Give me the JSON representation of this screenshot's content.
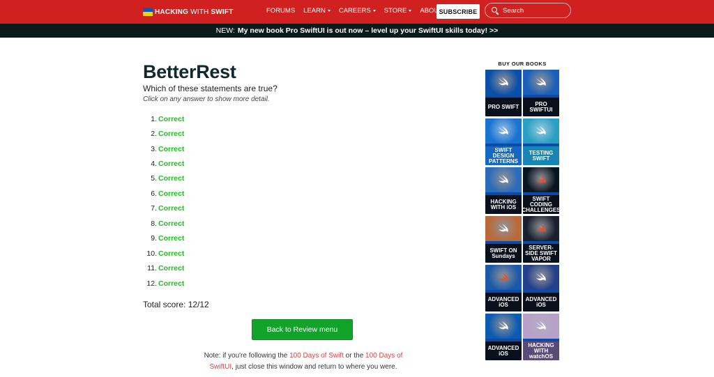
{
  "header": {
    "logo_bold": "HACKING",
    "logo_thin": "WITH",
    "logo_bold2": "SWIFT",
    "nav": [
      {
        "label": "FORUMS",
        "dropdown": false
      },
      {
        "label": "LEARN",
        "dropdown": true
      },
      {
        "label": "CAREERS",
        "dropdown": true
      },
      {
        "label": "STORE",
        "dropdown": true
      },
      {
        "label": "ABOUT",
        "dropdown": true
      }
    ],
    "subscribe_label": "SUBSCRIBE",
    "search_placeholder": "Search"
  },
  "banner": {
    "prefix": "NEW:",
    "text": "My new book Pro SwiftUI is out now – level up your SwiftUI skills today! >>"
  },
  "main": {
    "title": "BetterRest",
    "question": "Which of these statements are true?",
    "hint": "Click on any answer to show more detail.",
    "answers": [
      {
        "num": "1.",
        "result": "Correct"
      },
      {
        "num": "2.",
        "result": "Correct"
      },
      {
        "num": "3.",
        "result": "Correct"
      },
      {
        "num": "4.",
        "result": "Correct"
      },
      {
        "num": "5.",
        "result": "Correct"
      },
      {
        "num": "6.",
        "result": "Correct"
      },
      {
        "num": "7.",
        "result": "Correct"
      },
      {
        "num": "8.",
        "result": "Correct"
      },
      {
        "num": "9.",
        "result": "Correct"
      },
      {
        "num": "10.",
        "result": "Correct"
      },
      {
        "num": "11.",
        "result": "Correct"
      },
      {
        "num": "12.",
        "result": "Correct"
      }
    ],
    "score": "Total score: 12/12",
    "back_label": "Back to Review menu",
    "note_1": "Note: if you're following the ",
    "note_link_1": "100 Days of Swift",
    "note_2": " or the ",
    "note_link_2": "100 Days of SwiftUI",
    "note_3": ", just close this window and return to where you were."
  },
  "sidebar": {
    "title": "BUY OUR BOOKS",
    "books": [
      {
        "label": "PRO SWIFT",
        "bg": "#0b4fa8",
        "bottom": "#0a0f1c"
      },
      {
        "label": "PRO SWIFTUI",
        "bg": "#1a5fb8",
        "bottom": "#0a0f1c"
      },
      {
        "label": "SWIFT DESIGN PATTERNS",
        "bg": "#1873d1",
        "bottom": "#1567c2"
      },
      {
        "label": "TESTING SWIFT",
        "bg": "#2a9fc4",
        "bottom": "#1786b4"
      },
      {
        "label": "HACKING WITH iOS",
        "bg": "#2c6bb8",
        "bottom": "#0a0f1c"
      },
      {
        "label": "SWIFT CODING CHALLENGES",
        "bg": "#0a1522",
        "bottom": "#0a0f1c"
      },
      {
        "label": "SWIFT ON Sundays",
        "bg": "#b96a3a",
        "bottom": "#0a0f1c"
      },
      {
        "label": "SERVER-SIDE SWIFT VAPOR",
        "bg": "#1a2030",
        "bottom": "#0a0f1c"
      },
      {
        "label": "ADVANCED iOS",
        "bg": "#1c5aa8",
        "bottom": "#0a0f1c"
      },
      {
        "label": "ADVANCED iOS",
        "bg": "#23408a",
        "bottom": "#0a0f1c"
      },
      {
        "label": "ADVANCED iOS",
        "bg": "#0d5bb0",
        "bottom": "#0a0f1c"
      },
      {
        "label": "HACKING WITH watchOS",
        "bg": "#b8a0c8",
        "bottom": "#5a4a78"
      }
    ]
  }
}
